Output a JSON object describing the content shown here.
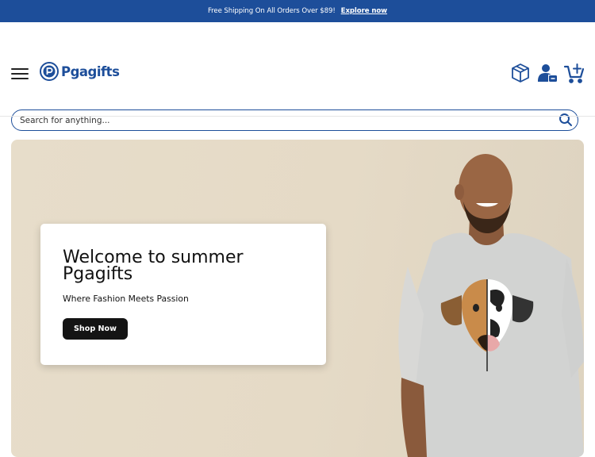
{
  "announcement": {
    "text": "Free Shipping On All Orders Over $89!",
    "link_label": "Explore now"
  },
  "brand": {
    "name": "Pgagifts"
  },
  "search": {
    "placeholder": "Search for anything..."
  },
  "header_icons": [
    "package-icon",
    "account-icon",
    "cart-icon"
  ],
  "hero": {
    "title": "Welcome to summer Pgagifts",
    "subtitle": "Where Fashion Meets Passion",
    "button_label": "Shop Now"
  },
  "colors": {
    "brand_blue": "#1d4e9a",
    "hero_bg": "#e6dcc8",
    "button_bg": "#141414"
  }
}
